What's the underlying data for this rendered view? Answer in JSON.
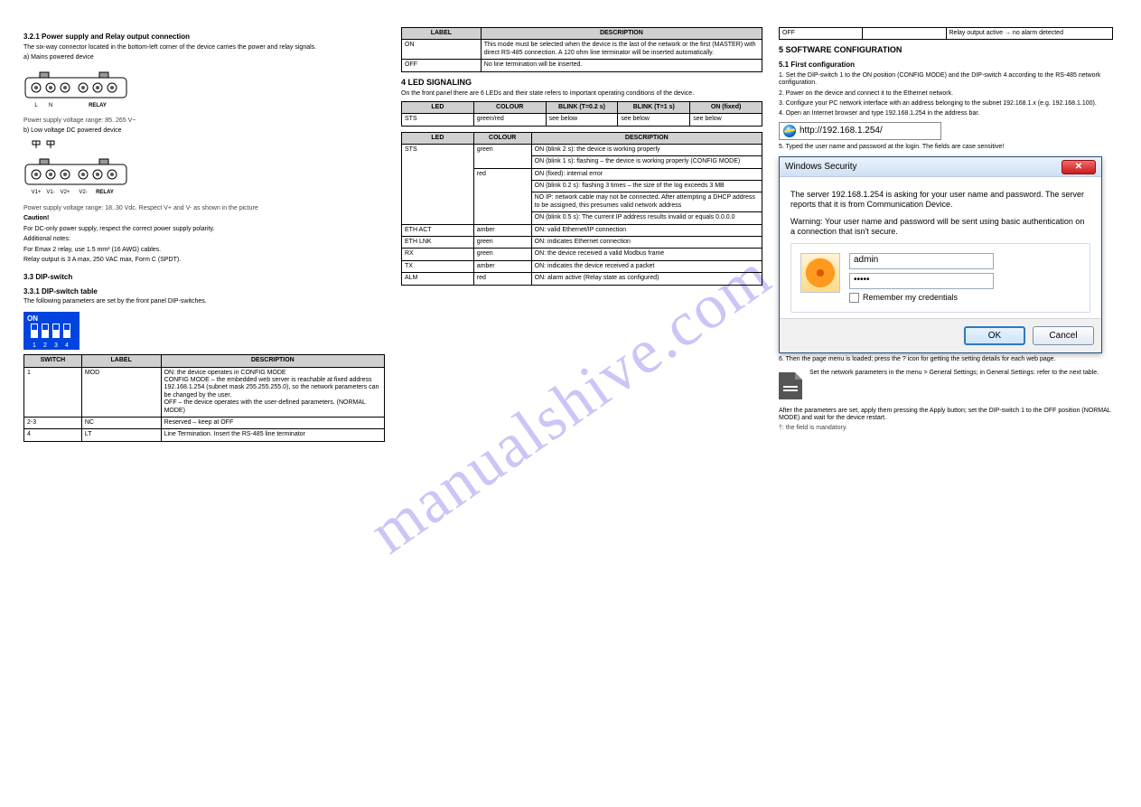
{
  "watermark": "manualshive.com",
  "col1": {
    "s321_title": "3.2.1 Power supply and Relay output connection",
    "p321_1": "The six-way connector located in the bottom-left corner of the device carries the power and relay signals.",
    "fig_a": "a) Mains powered device",
    "fig_a_note": "Power supply voltage range: 85..265 V~",
    "fig_b": "b) Low voltage DC powered device",
    "fig_b_note": "Power supply voltage range: 18..30 Vdc. Respect V+ and V- as shown in the picture",
    "caution_title": "Caution!",
    "caution_1": "For DC-only power supply, respect the correct power supply polarity.",
    "caution_2": "Additional notes:",
    "caution_3": "For Emax 2 relay, use 1.5 mm² (16 AWG) cables.",
    "caution_4": "Relay output is 3 A max, 250 VAC max, Form C (SPDT).",
    "s33_title": "3.3 DIP-switch",
    "s331_title": "3.3.1 DIP-switch table",
    "p331": "The following parameters are set by the front panel DIP-switches.",
    "sw_table": {
      "h": [
        "SWITCH",
        "LABEL",
        "DESCRIPTION"
      ],
      "rows": [
        [
          "1",
          "MOD",
          "ON: the device operates in CONFIG MODE\nCONFIG MODE – the embedded web server is reachable at fixed address 192.168.1.254 (subnet mask 255.255.255.0), so the network parameters can be changed by the user.\nOFF – the device operates with the user-defined parameters. (NORMAL MODE)"
        ],
        [
          "2-3",
          "NC",
          "Reserved – keep at OFF"
        ],
        [
          "4",
          "LT",
          "Line Termination. Insert the RS-485 line terminator"
        ]
      ]
    }
  },
  "col2": {
    "tbl_top": {
      "h": [
        "LABEL",
        "DESCRIPTION"
      ],
      "rows": [
        [
          "ON",
          "This mode must be selected when the device is the last of the network or the first (MASTER) with direct RS-485 connection. A 120 ohm line terminator will be inserted automatically."
        ],
        [
          "OFF",
          "No line termination will be inserted."
        ]
      ]
    },
    "led_title": "4 LED SIGNALING",
    "led_p": "On the front panel there are 6 LEDs and their state refers to important operating conditions of the device.",
    "tbl_led_colors": {
      "h": [
        "LED",
        "COLOUR",
        "BLINK (T=0.2 s)",
        "BLINK (T=1 s)",
        "ON (fixed)"
      ],
      "rows": [
        [
          "STS",
          "green/red",
          "see below",
          "see below",
          "see below"
        ]
      ]
    },
    "tbl_sts": {
      "h": [
        "LED",
        "COLOUR",
        "DESCRIPTION"
      ],
      "rows": [
        [
          "STS",
          "green",
          "ON (blink 2 s): the device is working properly"
        ],
        [
          "",
          "",
          "ON (blink 1 s): flashing – the device is working properly (CONFIG MODE)"
        ],
        [
          "",
          "red",
          "ON (fixed): internal error"
        ],
        [
          "",
          "",
          "ON (blink 0.2 s): flashing 3 times – the size of the log exceeds 3 MB"
        ],
        [
          "",
          "",
          "NO IP: network cable may not be connected. After attempting a DHCP address to be assigned, this presumes valid network address"
        ],
        [
          "",
          "",
          "ON (blink 0.5 s): The current IP address results invalid or equals 0.0.0.0"
        ],
        [
          "ETH ACT",
          "amber",
          "ON: valid Ethernet/IP connection"
        ],
        [
          "ETH LNK",
          "green",
          "ON: indicates Ethernet connection"
        ],
        [
          "RX",
          "green",
          "ON: the device received a valid Modbus frame"
        ],
        [
          "TX",
          "amber",
          "ON: indicates the device received a packet"
        ],
        [
          "ALM",
          "red",
          "ON: alarm active (Relay state as configured)"
        ]
      ]
    }
  },
  "col3": {
    "tbl_top": {
      "h": [
        "OFF",
        "",
        "Relay output active → no alarm detected"
      ]
    },
    "s5_title": "5 SOFTWARE CONFIGURATION",
    "s51_title": "5.1 First configuration",
    "ol": [
      "Set the DIP-switch 1 to the ON position (CONFIG MODE) and the DIP-switch 4 according to the RS-485 network configuration.",
      "Power on the device and connect it to the Ethernet network.",
      "Configure your PC network interface with an address belonging to the subnet 192.168.1.x (e.g. 192.168.1.100).",
      "Open an Internet browser and type 192.168.1.254 in the address bar."
    ],
    "ie_addr": "http://192.168.1.254/",
    "li5": "5. Typed the user name and password at the login. The fields are case sensitive!",
    "dlg": {
      "title": "Windows Security",
      "msg1": "The server 192.168.1.254 is asking for your user name and password. The server reports that it is from Communication Device.",
      "msg2": "Warning: Your user name and password will be sent using basic authentication on a connection that isn't secure.",
      "user": "admin",
      "pass": "•••••",
      "remember": "Remember my credentials",
      "ok": "OK",
      "cancel": "Cancel"
    },
    "li6": "6. Then the page menu is loaded; press the ? icon for getting the setting details for each web page.",
    "note_block": "Set the network parameters in the menu > General Settings; in General Settings: refer to the next table.",
    "after_cfg": "After the parameters are set, apply them pressing the Apply button; set the DIP-switch 1 to the OFF position (NORMAL MODE) and wait for the device restart.",
    "p4": "†: the field is mandatory."
  }
}
